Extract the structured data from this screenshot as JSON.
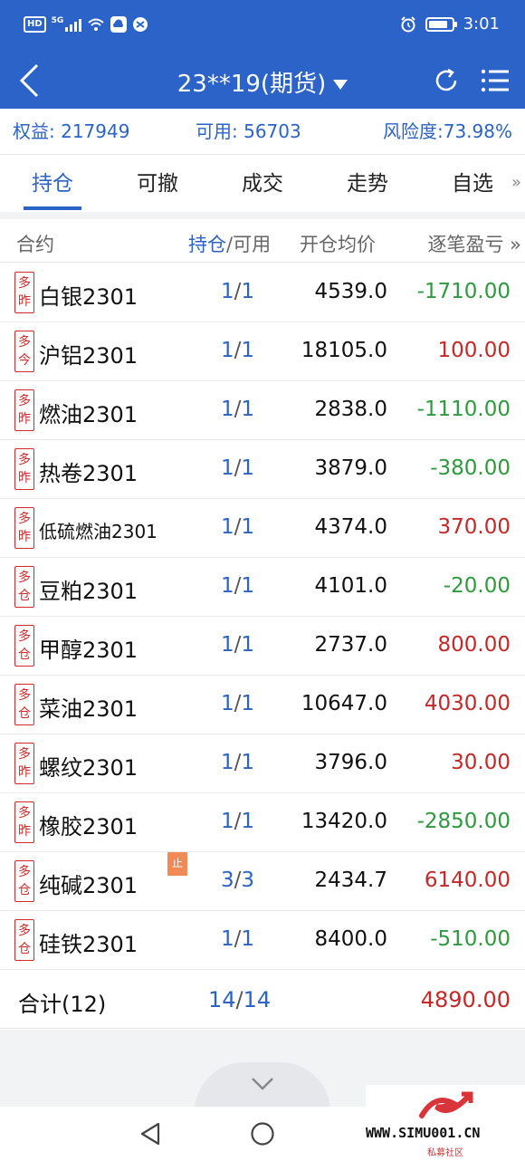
{
  "status_bar": {
    "time": "3:01",
    "network": "HD",
    "signal_label": "5G"
  },
  "header": {
    "title": "23**19(期货)"
  },
  "account": {
    "equity": "权益: 217949",
    "available": "可用: 56703",
    "risk": "风险度:73.98%"
  },
  "tabs": [
    {
      "label": "持仓",
      "active": true
    },
    {
      "label": "可撤",
      "active": false
    },
    {
      "label": "成交",
      "active": false
    },
    {
      "label": "走势",
      "active": false
    },
    {
      "label": "自选",
      "active": false
    }
  ],
  "tabs_more": "»",
  "columns": {
    "contract": "合约",
    "position": "持仓",
    "available": "/可用",
    "avg_price": "开仓均价",
    "pnl": "逐笔盈亏 »"
  },
  "rows": [
    {
      "tag_top": "多",
      "tag_bottom": "昨",
      "name": "白银2301",
      "held": "1",
      "avail": "1",
      "price": "4539.0",
      "pnl": "-1710.00",
      "pnl_color": "#2e9a3e"
    },
    {
      "tag_top": "多",
      "tag_bottom": "今",
      "name": "沪铝2301",
      "held": "1",
      "avail": "1",
      "price": "18105.0",
      "pnl": "100.00",
      "pnl_color": "#c62828"
    },
    {
      "tag_top": "多",
      "tag_bottom": "昨",
      "name": "燃油2301",
      "held": "1",
      "avail": "1",
      "price": "2838.0",
      "pnl": "-1110.00",
      "pnl_color": "#2e9a3e"
    },
    {
      "tag_top": "多",
      "tag_bottom": "昨",
      "name": "热卷2301",
      "held": "1",
      "avail": "1",
      "price": "3879.0",
      "pnl": "-380.00",
      "pnl_color": "#2e9a3e"
    },
    {
      "tag_top": "多",
      "tag_bottom": "昨",
      "name": "低硫燃油2301",
      "held": "1",
      "avail": "1",
      "price": "4374.0",
      "pnl": "370.00",
      "pnl_color": "#c62828"
    },
    {
      "tag_top": "多",
      "tag_bottom": "仓",
      "name": "豆粕2301",
      "held": "1",
      "avail": "1",
      "price": "4101.0",
      "pnl": "-20.00",
      "pnl_color": "#2e9a3e"
    },
    {
      "tag_top": "多",
      "tag_bottom": "仓",
      "name": "甲醇2301",
      "held": "1",
      "avail": "1",
      "price": "2737.0",
      "pnl": "800.00",
      "pnl_color": "#c62828"
    },
    {
      "tag_top": "多",
      "tag_bottom": "仓",
      "name": "菜油2301",
      "held": "1",
      "avail": "1",
      "price": "10647.0",
      "pnl": "4030.00",
      "pnl_color": "#c62828"
    },
    {
      "tag_top": "多",
      "tag_bottom": "昨",
      "name": "螺纹2301",
      "held": "1",
      "avail": "1",
      "price": "3796.0",
      "pnl": "30.00",
      "pnl_color": "#c62828"
    },
    {
      "tag_top": "多",
      "tag_bottom": "昨",
      "name": "橡胶2301",
      "held": "1",
      "avail": "1",
      "price": "13420.0",
      "pnl": "-2850.00",
      "pnl_color": "#2e9a3e"
    },
    {
      "tag_top": "多",
      "tag_bottom": "仓",
      "name": "纯碱2301",
      "held": "3",
      "avail": "3",
      "price": "2434.7",
      "pnl": "6140.00",
      "pnl_color": "#c62828",
      "stop": "止"
    },
    {
      "tag_top": "多",
      "tag_bottom": "仓",
      "name": "硅铁2301",
      "held": "1",
      "avail": "1",
      "price": "8400.0",
      "pnl": "-510.00",
      "pnl_color": "#2e9a3e"
    }
  ],
  "total": {
    "label": "合计(12)",
    "held": "14",
    "avail": "14",
    "pnl": "4890.00"
  },
  "watermark": {
    "url": "WWW.SIMU001.CN",
    "subtitle": "私募社区"
  }
}
